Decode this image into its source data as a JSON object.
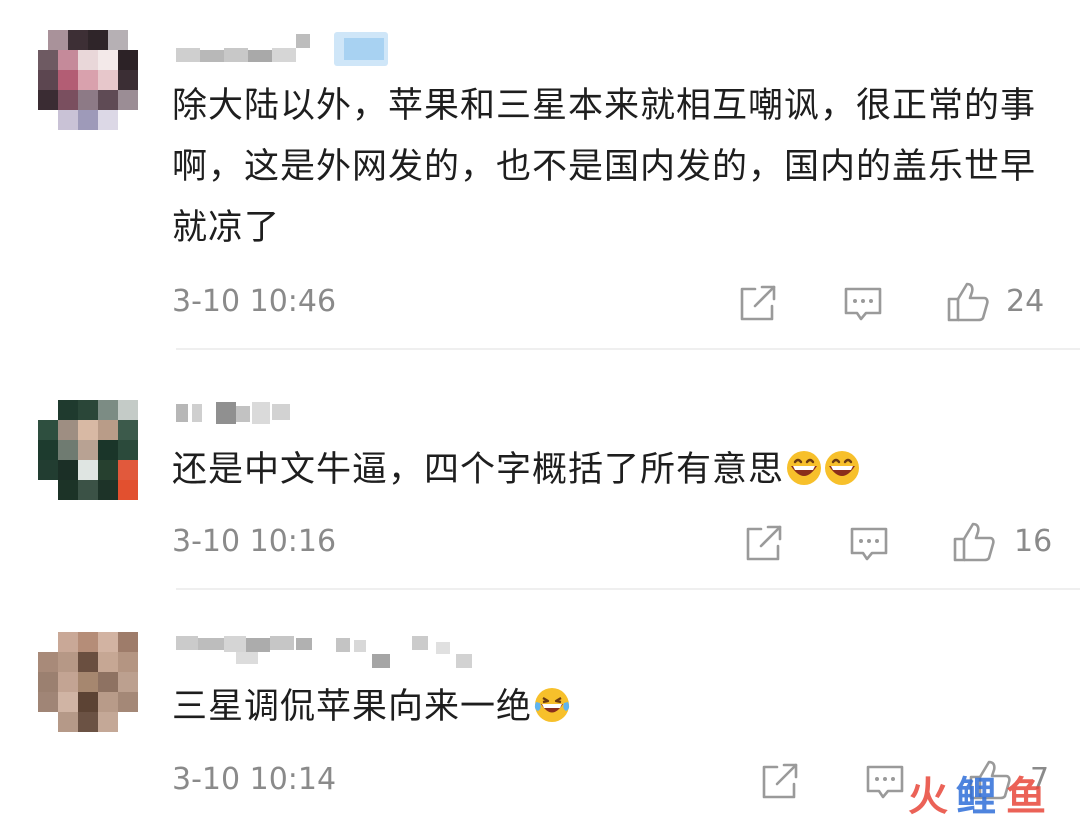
{
  "colors": {
    "text": "#1e1e1e",
    "meta": "#8a8a8a",
    "icon": "#9a9a9a",
    "divider": "#efefef",
    "watermark_red": "#e8473a",
    "watermark_blue": "#2f6fd8"
  },
  "comments": [
    {
      "username": "",
      "text": "除大陆以外，苹果和三星本来就相互嘲讽，很正常的事啊，这是外网发的，也不是国内发的，国内的盖乐世早就凉了",
      "emoji_count": 0,
      "time": "3-10 10:46",
      "likes": "24",
      "icons": [
        "share-icon",
        "reply-icon",
        "like-icon"
      ]
    },
    {
      "username": "",
      "text": "还是中文牛逼，四个字概括了所有意思",
      "emoji": "grinning-face-emoji",
      "emoji_count": 2,
      "time": "3-10 10:16",
      "likes": "16",
      "icons": [
        "share-icon",
        "reply-icon",
        "like-icon"
      ]
    },
    {
      "username": "",
      "text": "三星调侃苹果向来一绝",
      "emoji": "laughing-tears-emoji",
      "emoji_count": 1,
      "time": "3-10 10:14",
      "likes": "7",
      "icons": [
        "share-icon",
        "reply-icon",
        "like-icon"
      ]
    }
  ],
  "watermark": {
    "text": "火鲤鱼"
  }
}
